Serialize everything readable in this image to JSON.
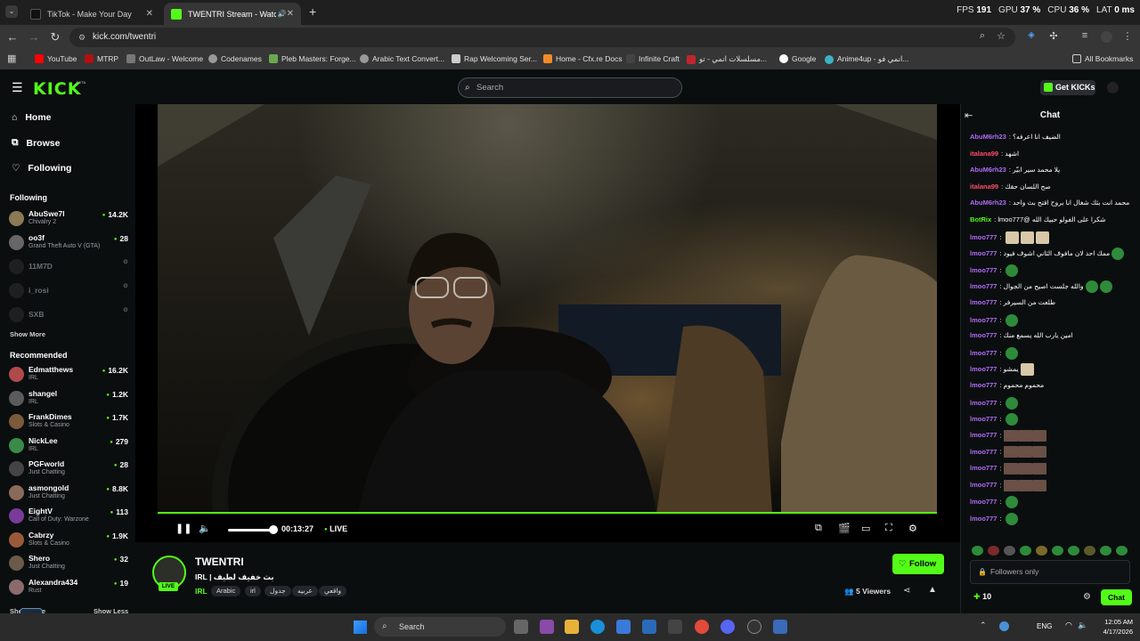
{
  "browser": {
    "tabs": [
      {
        "title": "TikTok - Make Your Day",
        "active": false
      },
      {
        "title": "TWENTRI Stream - Watch L",
        "active": true
      }
    ],
    "stats": {
      "fps_label": "FPS",
      "fps": "191",
      "gpu_label": "GPU",
      "gpu": "37 %",
      "cpu_label": "CPU",
      "cpu": "36 %",
      "lat_label": "LAT",
      "lat": "0 ms"
    },
    "url": "kick.com/twentri",
    "bookmarks": [
      "YouTube",
      "MTRP",
      "OutLaw - Welcome",
      "Codenames",
      "Pleb Masters: Forge...",
      "Arabic Text Convert...",
      "Rap Welcoming Ser...",
      "Home - Cfx.re Docs",
      "Infinite Craft",
      "مسلسلات انمي - تو...",
      "Google",
      "Anime4up - انمي فو..."
    ],
    "all_bookmarks": "All Bookmarks"
  },
  "site": {
    "logo": "KICK",
    "logo_beta": "BETA",
    "search_placeholder": "Search",
    "get_kicks": "Get KICKs"
  },
  "sidebar": {
    "nav": [
      "Home",
      "Browse",
      "Following"
    ],
    "following_title": "Following",
    "following": [
      {
        "name": "AbuSwe7l",
        "game": "Chivalry 2",
        "viewers": "14.2K",
        "live": true,
        "color": "#8a7a55"
      },
      {
        "name": "oo3f",
        "game": "Grand Theft Auto V (GTA)",
        "viewers": "28",
        "live": true,
        "color": "#666"
      },
      {
        "name": "11M7D",
        "game": "",
        "viewers": "",
        "live": false,
        "color": "#444"
      },
      {
        "name": "i_rosi",
        "game": "",
        "viewers": "",
        "live": false,
        "color": "#444"
      },
      {
        "name": "SXB",
        "game": "",
        "viewers": "",
        "live": false,
        "color": "#444"
      }
    ],
    "show_more": "Show More",
    "recommended_title": "Recommended",
    "recommended": [
      {
        "name": "Edmatthews",
        "game": "IRL",
        "viewers": "16.2K",
        "color": "#b04a4a"
      },
      {
        "name": "shangel",
        "game": "IRL",
        "viewers": "1.2K",
        "color": "#5b5b5b"
      },
      {
        "name": "FrankDimes",
        "game": "Slots & Casino",
        "viewers": "1.7K",
        "color": "#7a5a3a"
      },
      {
        "name": "NickLee",
        "game": "IRL",
        "viewers": "279",
        "color": "#3a8a4a"
      },
      {
        "name": "PGFworld",
        "game": "Just Chatting",
        "viewers": "28",
        "color": "#444"
      },
      {
        "name": "asmongold",
        "game": "Just Chatting",
        "viewers": "8.8K",
        "color": "#8a6a5a"
      },
      {
        "name": "EightV",
        "game": "Call of Duty: Warzone",
        "viewers": "113",
        "color": "#7a3a9a"
      },
      {
        "name": "Cabrzy",
        "game": "Slots & Casino",
        "viewers": "1.9K",
        "color": "#9a5a3a"
      },
      {
        "name": "Shero",
        "game": "Just Chatting",
        "viewers": "32",
        "color": "#6a5a4a"
      },
      {
        "name": "Alexandra434",
        "game": "Rust",
        "viewers": "19",
        "color": "#8a6a6a"
      }
    ],
    "bottom_show_more": "Show More",
    "show_less": "Show Less"
  },
  "player": {
    "time": "00:13:27",
    "live_label": "LIVE",
    "progress": 1.0,
    "volume": 0.55
  },
  "stream": {
    "streamer": "TWENTRI",
    "title": "بث خفيف لطيف | IRL",
    "live_badge": "LIVE",
    "category": "IRL",
    "tags": [
      "Arabic",
      "irl",
      "جدول",
      "عربيه",
      "واقعي"
    ],
    "viewers": "5",
    "viewers_label": "Viewers",
    "follow": "Follow"
  },
  "chat": {
    "title": "Chat",
    "messages": [
      {
        "user": "AbuM6rh23",
        "color": "#b06cf5",
        "text": "الضيف انا اعرفه؟",
        "emotes": ""
      },
      {
        "user": "italana99",
        "color": "#ff4d6d",
        "text": "اشهد",
        "emotes": ""
      },
      {
        "user": "AbuM6rh23",
        "color": "#b06cf5",
        "text": "يلا محمد سير ابيّر",
        "emotes": ""
      },
      {
        "user": "italana99",
        "color": "#ff4d6d",
        "text": "صح اللسان حقك",
        "emotes": ""
      },
      {
        "user": "AbuM6rh23",
        "color": "#b06cf5",
        "text": "محمد انت بثك شغال انا بروح افتح بث واحد",
        "emotes": ""
      },
      {
        "user": "BotRix",
        "color": "#53fc18",
        "text": "شكرا على الفولو حبيك الله @lmoo777",
        "emotes": ""
      },
      {
        "user": "lmoo777",
        "color": "#b06cf5",
        "text": "",
        "emotes": "sq3"
      },
      {
        "user": "lmoo777",
        "color": "#b06cf5",
        "text": "ممك احد لان مافوف الثاني اشوف فيود",
        "emotes": "g1"
      },
      {
        "user": "lmoo777",
        "color": "#b06cf5",
        "text": "",
        "emotes": "g1"
      },
      {
        "user": "lmoo777",
        "color": "#b06cf5",
        "text": "والله جلست اصيح من الجوال",
        "emotes": "g2"
      },
      {
        "user": "lmoo777",
        "color": "#b06cf5",
        "text": "طلعت من السيرفر",
        "emotes": ""
      },
      {
        "user": "lmoo777",
        "color": "#b06cf5",
        "text": "",
        "emotes": "g1"
      },
      {
        "user": "lmoo777",
        "color": "#b06cf5",
        "text": "امين يارب الله يسمع منك",
        "emotes": ""
      },
      {
        "user": "lmoo777",
        "color": "#b06cf5",
        "text": "",
        "emotes": "g1"
      },
      {
        "user": "lmoo777",
        "color": "#b06cf5",
        "text": "يمشو",
        "emotes": "sq1"
      },
      {
        "user": "lmoo777",
        "color": "#b06cf5",
        "text": "محموم محموم",
        "emotes": ""
      },
      {
        "user": "lmoo777",
        "color": "#b06cf5",
        "text": "",
        "emotes": "g1"
      },
      {
        "user": "lmoo777",
        "color": "#b06cf5",
        "text": "",
        "emotes": "g1"
      },
      {
        "user": "lmoo777",
        "color": "#b06cf5",
        "text": "",
        "emotes": "br3"
      },
      {
        "user": "lmoo777",
        "color": "#b06cf5",
        "text": "",
        "emotes": "br3"
      },
      {
        "user": "lmoo777",
        "color": "#b06cf5",
        "text": "",
        "emotes": "br3"
      },
      {
        "user": "lmoo777",
        "color": "#b06cf5",
        "text": "",
        "emotes": "br3"
      },
      {
        "user": "lmoo777",
        "color": "#b06cf5",
        "text": "",
        "emotes": "g1"
      },
      {
        "user": "lmoo777",
        "color": "#b06cf5",
        "text": "",
        "emotes": "g1"
      }
    ],
    "input_placeholder": "Followers only",
    "points": "10",
    "send": "Chat"
  },
  "taskbar": {
    "search": "Search",
    "lang": "ENG",
    "time": "12:05 AM",
    "date": "4/17/2026",
    "overlay_level": "45"
  }
}
